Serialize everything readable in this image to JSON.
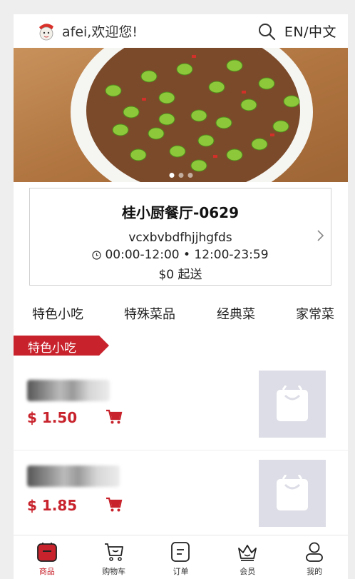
{
  "header": {
    "welcome": "afei,欢迎您!",
    "lang_label": "EN/中文"
  },
  "banner": {
    "dot_count": 3,
    "active_dot": 0
  },
  "store": {
    "name": "桂小厨餐厅-0629",
    "description": "vcxbvbdfhjjhgfds",
    "hours": "00:00-12:00 • 12:00-23:59",
    "minimum": "$0 起送"
  },
  "categories": [
    "特色小吃",
    "特殊菜品",
    "经典菜",
    "家常菜"
  ],
  "section": {
    "title": "特色小吃"
  },
  "items": [
    {
      "price": "$ 1.50"
    },
    {
      "price": "$ 1.85"
    }
  ],
  "tabbar": [
    {
      "label": "商品",
      "icon": "store-icon",
      "active": true
    },
    {
      "label": "购物车",
      "icon": "cart-icon",
      "active": false
    },
    {
      "label": "订单",
      "icon": "order-icon",
      "active": false
    },
    {
      "label": "会员",
      "icon": "crown-icon",
      "active": false
    },
    {
      "label": "我的",
      "icon": "user-icon",
      "active": false
    }
  ],
  "colors": {
    "accent": "#c8232c",
    "placeholder_bg": "#dcdde6"
  }
}
